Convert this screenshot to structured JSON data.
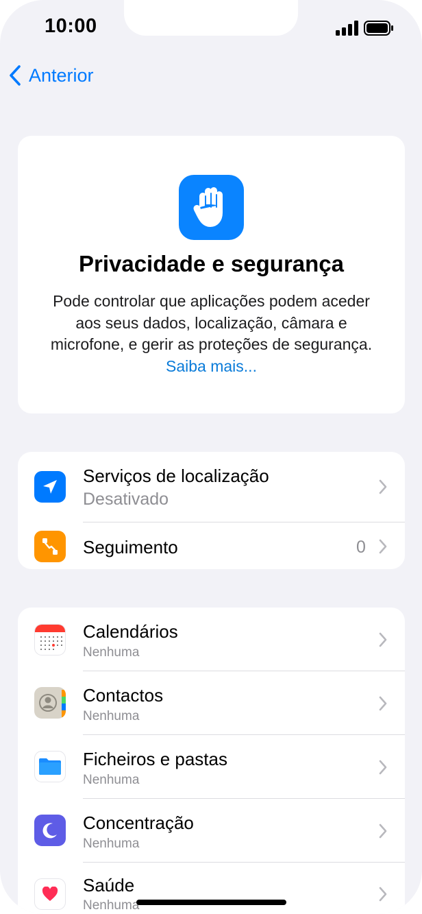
{
  "status_bar": {
    "time": "10:00"
  },
  "nav": {
    "back_label": "Anterior"
  },
  "hero": {
    "title": "Privacidade e segurança",
    "description": "Pode controlar que aplicações podem aceder aos seus dados, localização, câmara e microfone, e gerir as proteções de segurança.",
    "link_label": "Saiba mais...",
    "icon": "hand-raised-icon"
  },
  "location_group": [
    {
      "title": "Serviços de localização",
      "subtitle": "Desativado",
      "icon": "location-arrow-icon",
      "color": "#007aff"
    },
    {
      "title": "Seguimento",
      "count": "0",
      "icon": "tracking-icon",
      "color": "#ff9500"
    }
  ],
  "apps_group": [
    {
      "title": "Calendários",
      "subtitle": "Nenhuma",
      "icon": "calendar-icon"
    },
    {
      "title": "Contactos",
      "subtitle": "Nenhuma",
      "icon": "contacts-icon"
    },
    {
      "title": "Ficheiros e pastas",
      "subtitle": "Nenhuma",
      "icon": "folder-icon"
    },
    {
      "title": "Concentração",
      "subtitle": "Nenhuma",
      "icon": "moon-icon",
      "color": "#5e5ce6"
    },
    {
      "title": "Saúde",
      "subtitle": "Nenhuma",
      "icon": "heart-icon",
      "color": "#ff2d55"
    }
  ]
}
